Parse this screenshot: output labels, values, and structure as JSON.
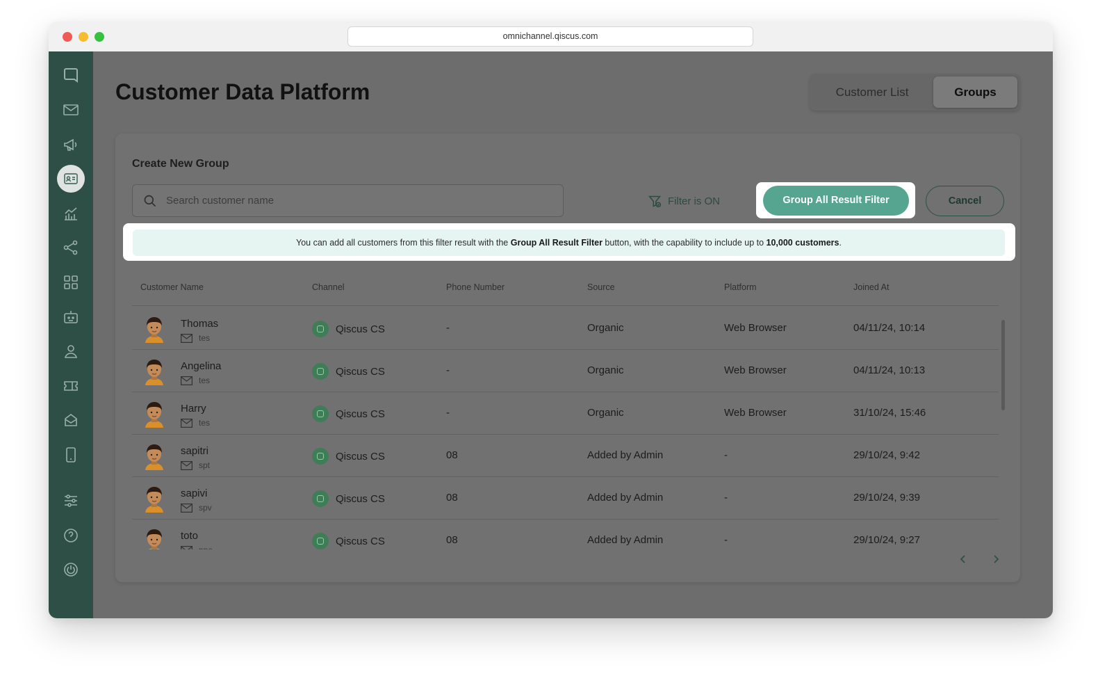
{
  "browser": {
    "url": "omnichannel.qiscus.com"
  },
  "page": {
    "title": "Customer Data Platform"
  },
  "tabs": [
    {
      "label": "Customer List"
    },
    {
      "label": "Groups"
    }
  ],
  "create_group": {
    "title": "Create New Group",
    "search_placeholder": "Search customer name",
    "filter_status": "Filter is ON",
    "group_button": "Group All Result Filter",
    "cancel_button": "Cancel",
    "info": {
      "prefix": "You can add all customers from this filter result with the",
      "button_name": "Group All Result Filter",
      "middle": "button, with the capability to include up to",
      "limit": "10,000 customers",
      "suffix": "."
    }
  },
  "table": {
    "columns": [
      "Customer Name",
      "Channel",
      "Phone Number",
      "Source",
      "Platform",
      "Joined At"
    ],
    "rows": [
      {
        "name": "Thomas",
        "email": "tes",
        "channel": "Qiscus CS",
        "phone": "-",
        "source": "Organic",
        "platform": "Web Browser",
        "joined": "04/11/24, 10:14"
      },
      {
        "name": "Angelina",
        "email": "tes",
        "channel": "Qiscus CS",
        "phone": "-",
        "source": "Organic",
        "platform": "Web Browser",
        "joined": "04/11/24, 10:13"
      },
      {
        "name": "Harry",
        "email": "tes",
        "channel": "Qiscus CS",
        "phone": "-",
        "source": "Organic",
        "platform": "Web Browser",
        "joined": "31/10/24, 15:46"
      },
      {
        "name": "sapitri",
        "email": "spt",
        "channel": "Qiscus CS",
        "phone": "08",
        "source": "Added by Admin",
        "platform": "-",
        "joined": "29/10/24, 9:42"
      },
      {
        "name": "sapivi",
        "email": "spv",
        "channel": "Qiscus CS",
        "phone": "08",
        "source": "Added by Admin",
        "platform": "-",
        "joined": "29/10/24, 9:39"
      },
      {
        "name": "toto",
        "email": "ppe",
        "channel": "Qiscus CS",
        "phone": "08",
        "source": "Added by Admin",
        "platform": "-",
        "joined": "29/10/24, 9:27"
      }
    ]
  },
  "sidebar": {
    "icons": [
      "chat-bubble-icon",
      "mail-icon",
      "megaphone-icon",
      "contact-card-icon",
      "analytics-icon",
      "integration-share-icon",
      "apps-grid-icon",
      "bot-icon",
      "agent-icon",
      "ticket-icon",
      "inbox-icon",
      "mobile-icon",
      "settings-sliders-icon",
      "help-icon",
      "power-icon"
    ],
    "active": "contact-card-icon"
  },
  "colors": {
    "sidebar": "#2e4f45",
    "accent": "#55a591",
    "overlay": "#6d6d6d",
    "info_bg": "#e6f5f1"
  }
}
